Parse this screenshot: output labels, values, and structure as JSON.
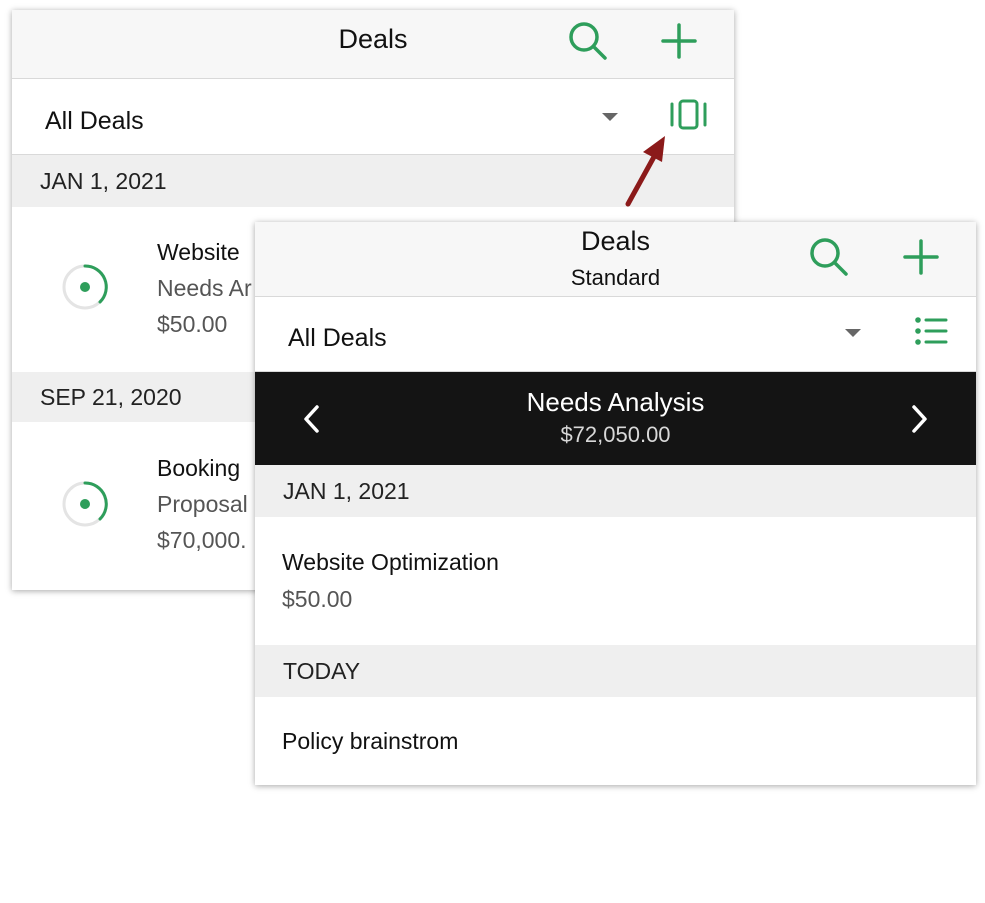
{
  "colors": {
    "accent": "#2e9e5b",
    "annotation_arrow": "#8b1a1a",
    "stage_bar_bg": "#141414"
  },
  "back_screen": {
    "nav": {
      "title": "Deals",
      "search_icon": "search-icon",
      "add_icon": "plus-icon"
    },
    "filter": {
      "label": "All Deals",
      "view_toggle_icon": "kanban-view-icon"
    },
    "sections": [
      {
        "header": "JAN 1, 2021",
        "deal": {
          "name": "Website",
          "stage": "Needs Ar",
          "amount": "$50.00"
        }
      },
      {
        "header": "SEP 21, 2020",
        "deal": {
          "name": "Booking",
          "stage": "Proposal",
          "amount": "$70,000."
        }
      }
    ]
  },
  "front_screen": {
    "nav": {
      "title": "Deals",
      "subtitle": "Standard",
      "search_icon": "search-icon",
      "add_icon": "plus-icon"
    },
    "filter": {
      "label": "All Deals",
      "view_toggle_icon": "list-view-icon"
    },
    "stage": {
      "name": "Needs Analysis",
      "total": "$72,050.00"
    },
    "sections": [
      {
        "header": "JAN 1, 2021",
        "deal": {
          "name": "Website Optimization",
          "amount": "$50.00"
        }
      },
      {
        "header": "TODAY",
        "deal": {
          "name": "Policy brainstrom"
        }
      }
    ]
  }
}
